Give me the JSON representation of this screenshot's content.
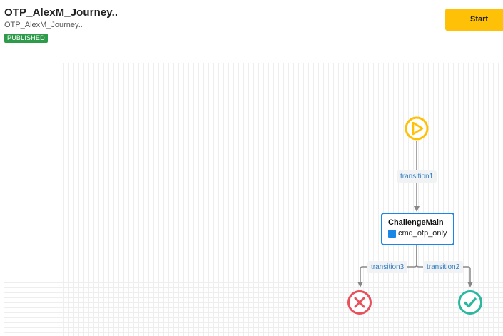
{
  "header": {
    "title": "OTP_AlexM_Journey..",
    "subtitle": "OTP_AlexM_Journey..",
    "status_badge": "PUBLISHED",
    "start_button_label": "Start"
  },
  "flow": {
    "start_node": {
      "icon": "play-icon",
      "color": "#ffc107"
    },
    "transitions": [
      {
        "label": "transition1"
      },
      {
        "label": "transition3"
      },
      {
        "label": "transition2"
      }
    ],
    "challenge_node": {
      "title": "ChallengeMain",
      "command": "cmd_otp_only",
      "icon": "command-square-icon",
      "border_color": "#1a86e6"
    },
    "end_failure": {
      "icon": "x-icon",
      "color": "#e8505b"
    },
    "end_success": {
      "icon": "check-icon",
      "color": "#2bb7a0"
    }
  },
  "colors": {
    "accent": "#ffc107",
    "published": "#2e9b4a",
    "link": "#2e7cc4"
  }
}
